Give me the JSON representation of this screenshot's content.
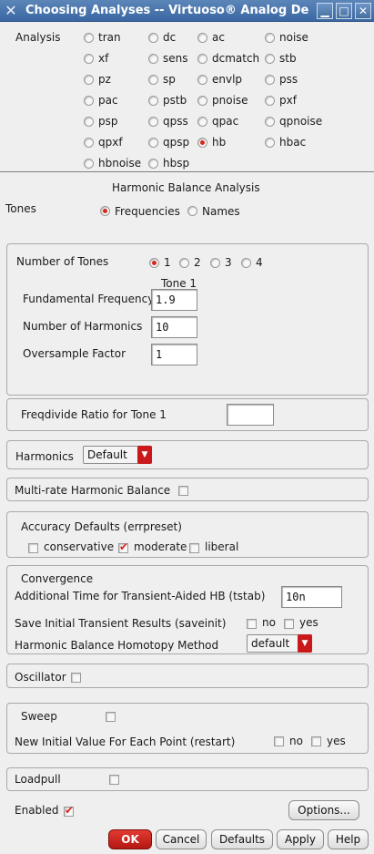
{
  "window": {
    "title": "Choosing Analyses -- Virtuoso® Analog De",
    "app_icon": "x-icon",
    "minimize_glyph": "▁",
    "maximize_glyph": "□",
    "close_glyph": "✕"
  },
  "analysis": {
    "label": "Analysis",
    "options": [
      "tran",
      "dc",
      "ac",
      "noise",
      "xf",
      "sens",
      "dcmatch",
      "stb",
      "pz",
      "sp",
      "envlp",
      "pss",
      "pac",
      "pstb",
      "pnoise",
      "pxf",
      "psp",
      "qpss",
      "qpac",
      "qpnoise",
      "qpxf",
      "qpsp",
      "hb",
      "hbac",
      "hbnoise",
      "hbsp"
    ],
    "selected": "hb"
  },
  "hb": {
    "heading": "Harmonic Balance Analysis",
    "tones_label": "Tones",
    "tones_options": [
      "Frequencies",
      "Names"
    ],
    "tones_selected": "Frequencies",
    "num_tones_label": "Number of Tones",
    "num_tones_options": [
      "1",
      "2",
      "3",
      "4"
    ],
    "num_tones_selected": "1",
    "tone_col_header": "Tone 1",
    "fund_freq_label": "Fundamental Frequency",
    "fund_freq_value": "1.9",
    "num_harm_label": "Number of Harmonics",
    "num_harm_value": "10",
    "oversample_label": "Oversample Factor",
    "oversample_value": "1",
    "freqdivide_label": "Freqdivide Ratio for Tone 1",
    "freqdivide_value": "",
    "harmonics_label": "Harmonics",
    "harmonics_value": "Default",
    "multirate_label": "Multi-rate Harmonic Balance",
    "multirate_checked": false,
    "accuracy_label": "Accuracy Defaults (errpreset)",
    "accuracy_options": [
      "conservative",
      "moderate",
      "liberal"
    ],
    "accuracy_selected": "moderate",
    "convergence_label": "Convergence",
    "tstab_label": "Additional Time for Transient-Aided HB (tstab)",
    "tstab_value": "10n",
    "saveinit_label": "Save Initial Transient Results (saveinit)",
    "no_label": "no",
    "yes_label": "yes",
    "homotopy_label": "Harmonic Balance Homotopy Method",
    "homotopy_value": "default",
    "oscillator_label": "Oscillator",
    "sweep_label": "Sweep",
    "restart_label": "New Initial Value For Each Point (restart)",
    "loadpull_label": "Loadpull",
    "enabled_label": "Enabled",
    "enabled_checked": true,
    "options_button": "Options..."
  },
  "buttons": {
    "ok": "OK",
    "cancel": "Cancel",
    "defaults": "Defaults",
    "apply": "Apply",
    "help": "Help"
  },
  "colors": {
    "titlebar": "#3a67a3",
    "accent_red": "#d8261c",
    "ok_button": "#c9191b"
  }
}
